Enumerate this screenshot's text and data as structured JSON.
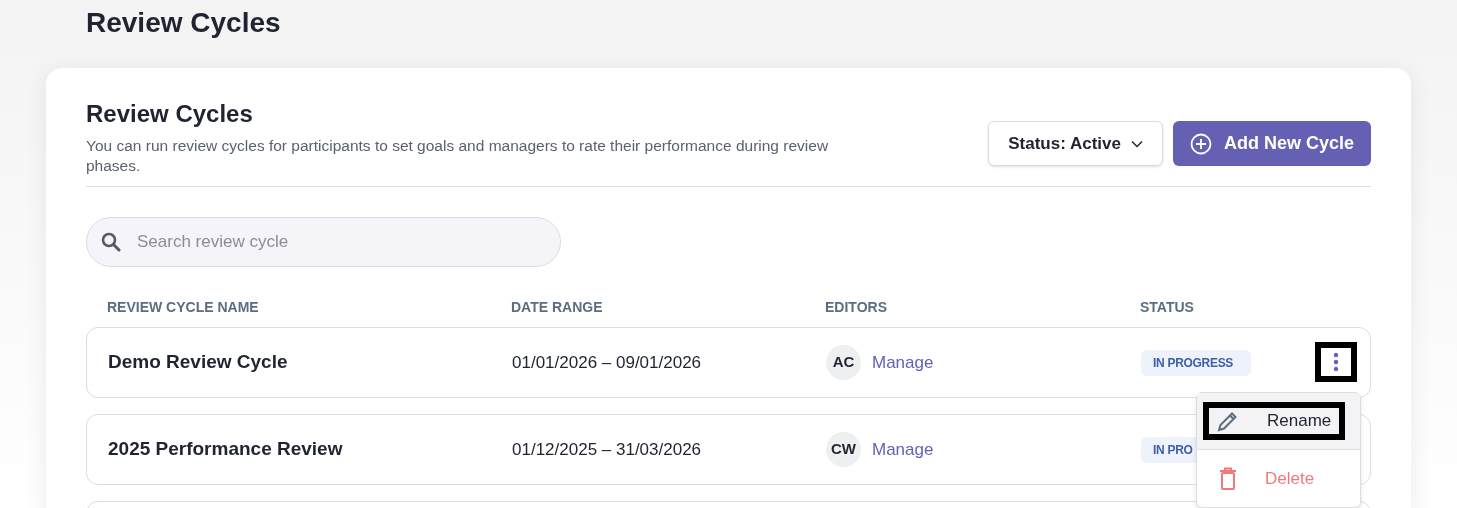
{
  "page_title": "Review Cycles",
  "card": {
    "title": "Review Cycles",
    "description": "You can run review cycles for participants to set goals and managers to rate their performance during review phases.",
    "status_filter": "Status: Active",
    "add_button": "Add New Cycle"
  },
  "search": {
    "placeholder": "Search review cycle"
  },
  "table": {
    "columns": [
      "REVIEW CYCLE NAME",
      "DATE RANGE",
      "EDITORS",
      "STATUS"
    ],
    "rows": [
      {
        "name": "Demo Review Cycle",
        "date_range": "01/01/2026 – 09/01/2026",
        "editor_initials": "AC",
        "manage": "Manage",
        "status": "IN PROGRESS",
        "menu_focused": true
      },
      {
        "name": "2025 Performance Review",
        "date_range": "01/12/2025 – 31/03/2026",
        "editor_initials": "CW",
        "manage": "Manage",
        "status": "IN PRO"
      }
    ]
  },
  "row_menu": {
    "items": [
      {
        "kind": "rename",
        "label": "Rename",
        "focused": true
      },
      {
        "kind": "delete",
        "label": "Delete",
        "focused": false
      }
    ]
  }
}
